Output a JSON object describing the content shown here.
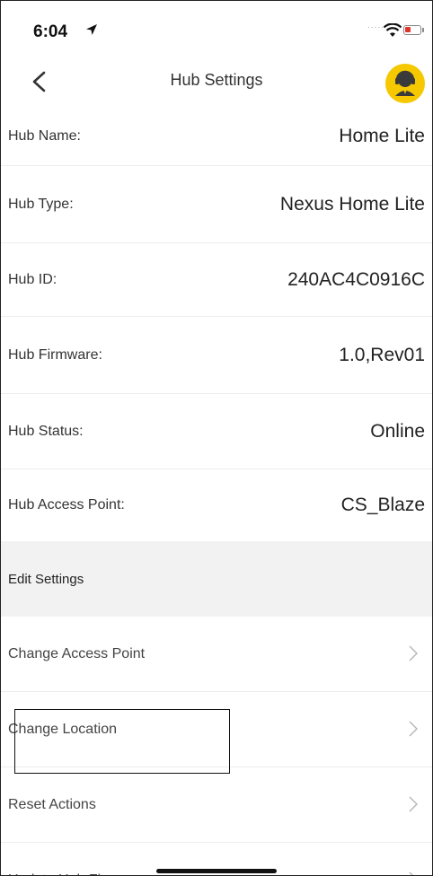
{
  "status_bar": {
    "time": "6:04",
    "signal_dots": "....."
  },
  "nav": {
    "title": "Hub Settings"
  },
  "hub_info": [
    {
      "label": "Hub Name:",
      "value": "Home Lite"
    },
    {
      "label": "Hub Type:",
      "value": "Nexus Home Lite"
    },
    {
      "label": "Hub ID:",
      "value": "240AC4C0916C"
    },
    {
      "label": "Hub Firmware:",
      "value": "1.0,Rev01"
    },
    {
      "label": "Hub Status:",
      "value": "Online"
    },
    {
      "label": "Hub Access Point:",
      "value": "CS_Blaze"
    }
  ],
  "edit_section": {
    "header": "Edit Settings",
    "actions": [
      {
        "label": "Change Access Point"
      },
      {
        "label": "Change Location"
      },
      {
        "label": "Reset Actions"
      },
      {
        "label": "Update Hub Firmware"
      }
    ]
  },
  "colors": {
    "accent_yellow": "#f5c800",
    "section_bg": "#f1f2f1",
    "battery_low": "#e0352b"
  },
  "icons": [
    "location-arrow-icon",
    "wifi-icon",
    "battery-icon",
    "back-chevron-icon",
    "support-agent-icon",
    "chevron-right-icon"
  ]
}
